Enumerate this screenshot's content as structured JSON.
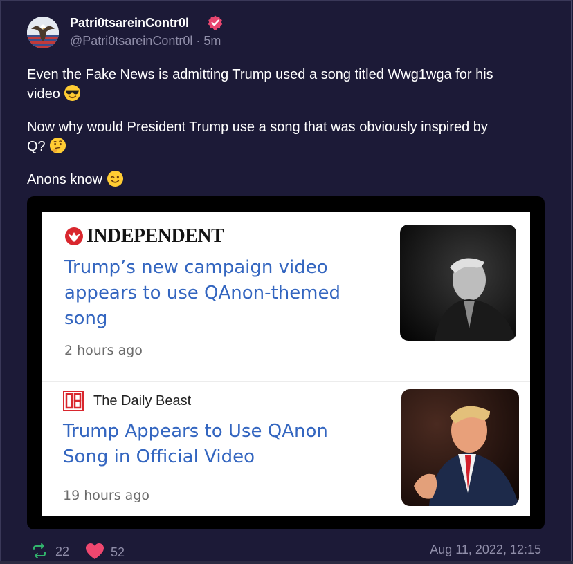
{
  "author": {
    "display_name": "Patri0tsareinContr0l",
    "handle": "@Patri0tsareinContr0l",
    "time_ago": "5m",
    "verified": true
  },
  "post": {
    "line1a": "Even the Fake News is admitting Trump used a song titled Wwg1wga for his",
    "line1b": "video",
    "emoji1": "sunglasses-emoji",
    "line2a": "Now why would President Trump use a song that was obviously inspired by",
    "line2b": "Q?",
    "emoji2": "thinking-emoji",
    "line3": "Anons know",
    "emoji3": "winking-emoji"
  },
  "media": {
    "articles": [
      {
        "source": "INDEPENDENT",
        "headline_lines": [
          "Trump’s new campaign video",
          "appears to use QAnon-themed",
          "song"
        ],
        "time": "2 hours ago"
      },
      {
        "source": "The Daily Beast",
        "source_logo": "DB",
        "headline_lines": [
          "Trump Appears to Use QAnon",
          "Song in Official Video"
        ],
        "time": "19 hours ago"
      }
    ]
  },
  "actions": {
    "reposts": "22",
    "likes": "52",
    "timestamp": "Aug 11, 2022, 12:15"
  },
  "colors": {
    "background": "#1c1a37",
    "verified_badge": "#e8466f",
    "repost_icon": "#31b46c",
    "like_icon": "#ef476f",
    "headline_link": "#3466c0"
  }
}
